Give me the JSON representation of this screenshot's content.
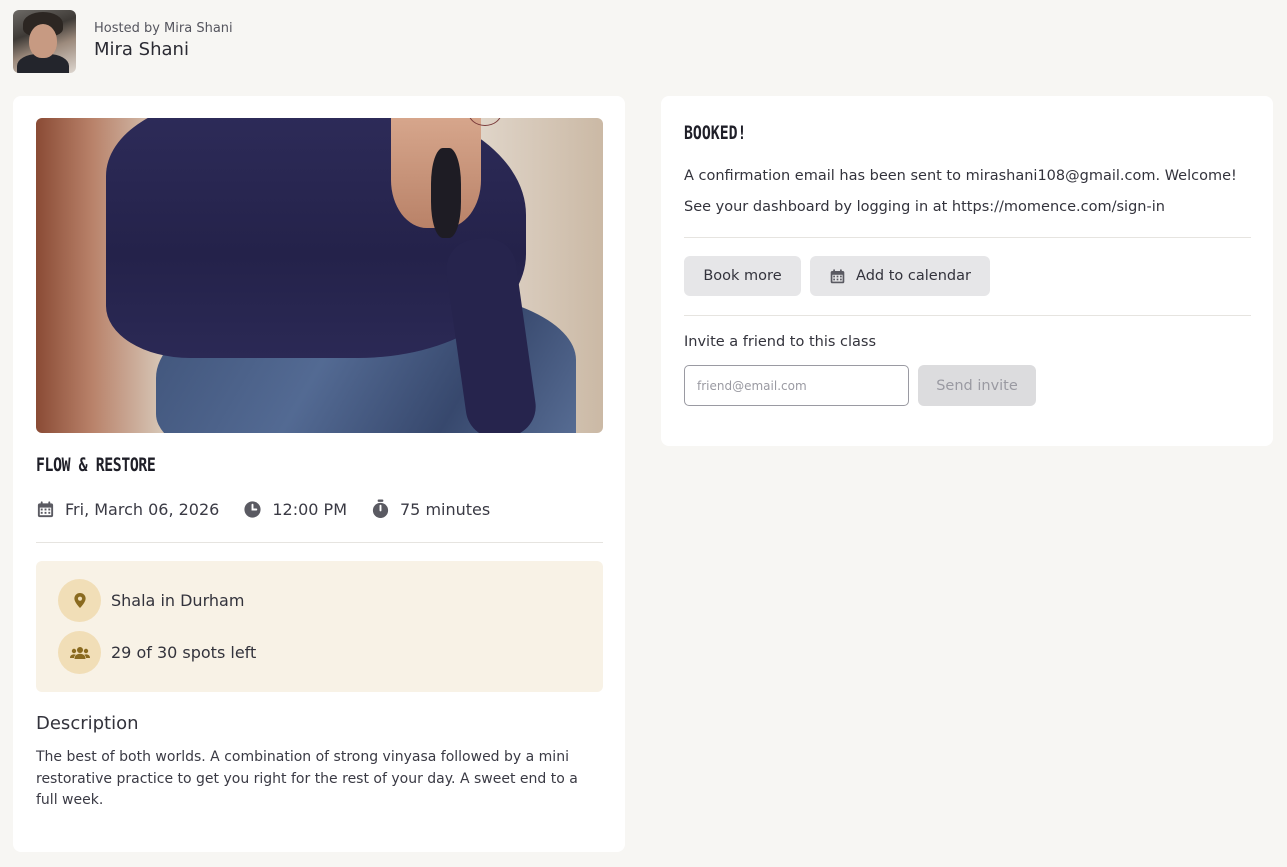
{
  "host": {
    "subtitle": "Hosted by Mira Shani",
    "name": "Mira Shani"
  },
  "class": {
    "title": "Flow & Restore",
    "date": "Fri, March 06, 2026",
    "time": "12:00 PM",
    "duration": "75 minutes",
    "location": "Shala in Durham",
    "spots": "29 of 30 spots left",
    "description_title": "Description",
    "description": "The best of both worlds. A combination of strong vinyasa followed by a mini restorative practice to get you right for the rest of your day. A sweet end to a full week."
  },
  "booking": {
    "title": "Booked!",
    "confirmation": "A confirmation email has been sent to mirashani108@gmail.com. Welcome!",
    "dashboard": "See your dashboard by logging in at https://momence.com/sign-in",
    "book_more": "Book more",
    "add_to_calendar": "Add to calendar"
  },
  "invite": {
    "label": "Invite a friend to this class",
    "placeholder": "friend@email.com",
    "send_label": "Send invite"
  },
  "colors": {
    "accent_gold": "#8a6a1f",
    "info_bg": "#f8f2e6",
    "icon_circle": "#f1deb7"
  }
}
